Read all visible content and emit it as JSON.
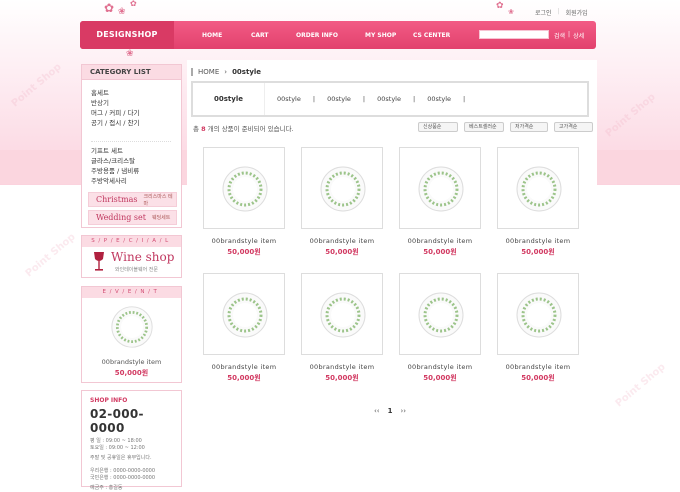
{
  "util": {
    "login": "로그인",
    "join": "회원가입"
  },
  "nav": {
    "logo": "DESIGNSHOP",
    "menu": [
      "HOME",
      "CART",
      "ORDER INFO",
      "MY SHOP",
      "CS CENTER"
    ],
    "search_btn": "검색",
    "detail_btn": "상세"
  },
  "sidebar": {
    "category_title": "CATEGORY LIST",
    "categories_a": [
      "홈세트",
      "반상기",
      "머그 / 커피 / 다기",
      "공기 / 접시 / 찬기"
    ],
    "categories_b": [
      "기프트 세트",
      "글라스/크리스탈",
      "주방용품 / 냄비류",
      "주방악세사리"
    ],
    "banner_christmas": {
      "big": "Christmas",
      "small": "크리스마스 테마"
    },
    "banner_wedding": {
      "big": "Wedding set",
      "small": "웨딩세트"
    },
    "special_head": "S/P/E/C/I/A/L",
    "wine_title": "Wine shop",
    "wine_sub": "와인테이블웨어 전문",
    "event_head": "E/V/E/N/T",
    "event_name": "00brandstyle item",
    "event_price": "50,000원",
    "info": {
      "head": "SHOP INFO",
      "phone": "02-000-0000",
      "lines": [
        "평    일 : 09:00 ~ 18:00",
        "토요일 : 09:00 ~ 12:00",
        "주말 및 공휴일은 휴무입니다.",
        "",
        "우리은행 : 0000-0000-0000",
        "국민은행 : 0000-0000-0000",
        "예금주 : 홍길동"
      ]
    }
  },
  "main": {
    "breadcrumb_home": "HOME",
    "breadcrumb_current": "00style",
    "sub_title": "00style",
    "sub_items": [
      "00style",
      "|",
      "00style",
      "|",
      "00style",
      "|",
      "00style",
      "|"
    ],
    "count_prefix": "총",
    "count_num": "8",
    "count_suffix": "개의 상품이 준비되어 있습니다.",
    "sort": [
      "신상품순",
      "베스트셀러순",
      "저가격순",
      "고가격순"
    ],
    "products": [
      {
        "name": "00brandstyle item",
        "price": "50,000원"
      },
      {
        "name": "00brandstyle item",
        "price": "50,000원"
      },
      {
        "name": "00brandstyle item",
        "price": "50,000원"
      },
      {
        "name": "00brandstyle item",
        "price": "50,000원"
      },
      {
        "name": "00brandstyle item",
        "price": "50,000원"
      },
      {
        "name": "00brandstyle item",
        "price": "50,000원"
      },
      {
        "name": "00brandstyle item",
        "price": "50,000원"
      },
      {
        "name": "00brandstyle item",
        "price": "50,000원"
      }
    ],
    "paging": {
      "prev": "‹‹",
      "current": "1",
      "next": "››"
    }
  },
  "watermark": "Point Shop",
  "colors": {
    "accent": "#e2416d",
    "price": "#d23a62",
    "pale": "#fbdbe3"
  }
}
